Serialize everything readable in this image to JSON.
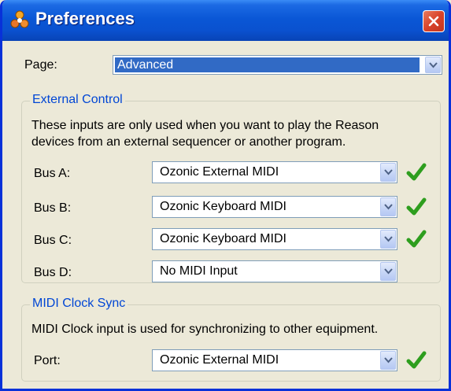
{
  "window": {
    "title": "Preferences",
    "close_icon": "close-icon",
    "app_icon": "reason-app-icon"
  },
  "page": {
    "label": "Page:",
    "selected": "Advanced"
  },
  "external_control": {
    "title": "External Control",
    "description_line1": "These inputs are only used when you want to play the Reason",
    "description_line2": "devices from an external sequencer or another program.",
    "buses": [
      {
        "label": "Bus A:",
        "value": "Ozonic External MIDI",
        "check": true
      },
      {
        "label": "Bus B:",
        "value": "Ozonic Keyboard MIDI",
        "check": true
      },
      {
        "label": "Bus C:",
        "value": "Ozonic Keyboard MIDI",
        "check": true
      },
      {
        "label": "Bus D:",
        "value": "No MIDI Input",
        "check": false
      }
    ]
  },
  "midi_clock": {
    "title": "MIDI Clock Sync",
    "description": "MIDI Clock input is used for synchronizing to other equipment.",
    "port_label": "Port:",
    "port_value": "Ozonic External MIDI",
    "check": true
  },
  "colors": {
    "titlebar": "#0a57d6",
    "group_title": "#0046d5",
    "check": "#2e9e1e",
    "selection": "#316ac5"
  }
}
